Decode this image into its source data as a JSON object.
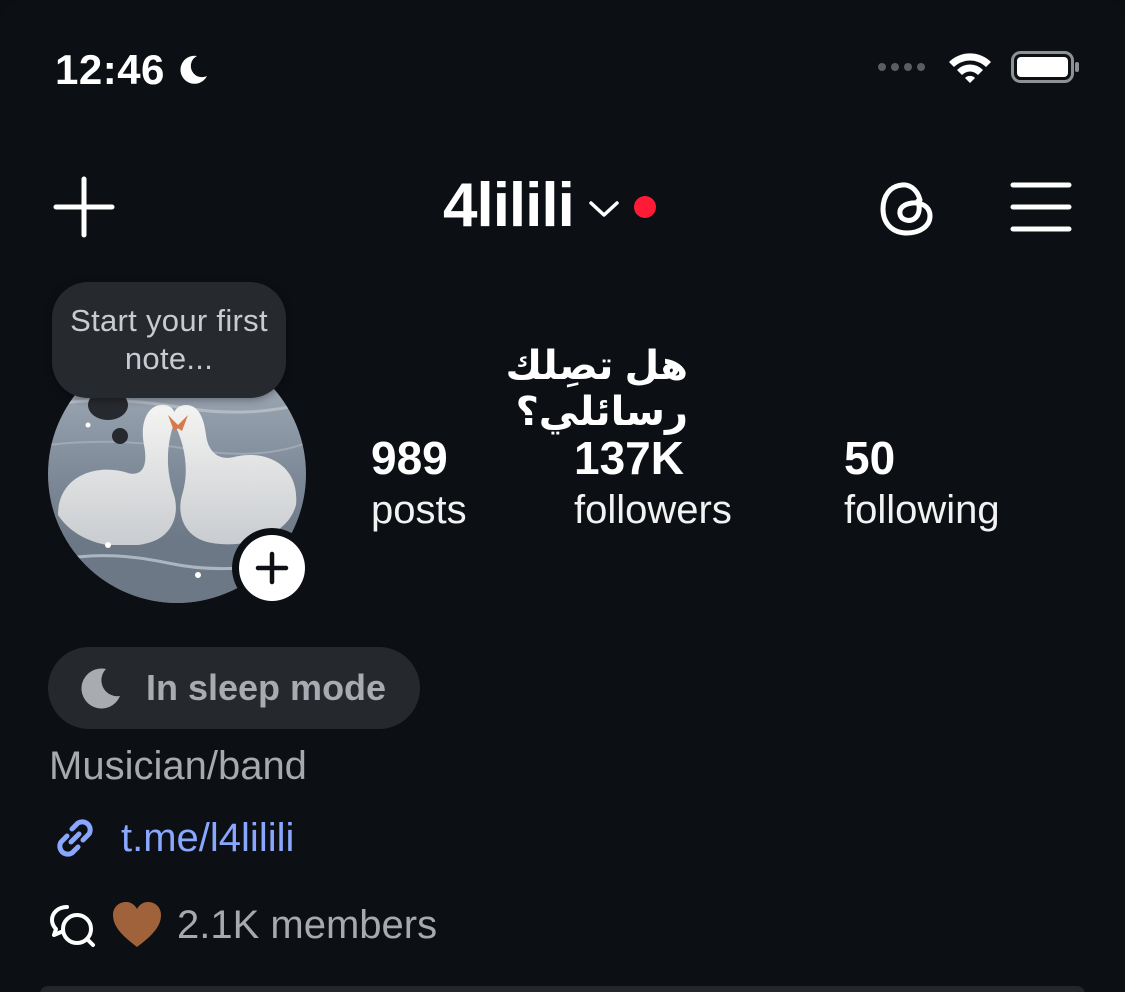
{
  "status_bar": {
    "time": "12:46"
  },
  "header": {
    "username": "4lilili"
  },
  "note": {
    "text": "Start your first note..."
  },
  "profile": {
    "bio_title": "هل تصِلك رسائلي؟",
    "stats": [
      {
        "value": "989",
        "label": "posts"
      },
      {
        "value": "137K",
        "label": "followers"
      },
      {
        "value": "50",
        "label": "following"
      }
    ],
    "sleep_mode": "In sleep mode",
    "category": "Musician/band",
    "link": "t.me/l4lilili",
    "members": "2.1K members"
  },
  "colors": {
    "background": "#0c0f14",
    "accent_red": "#ff1a36",
    "link_blue": "#8aa7ff",
    "heart_brown": "#a0623a"
  },
  "icons": [
    "moon-icon",
    "wifi-icon",
    "battery-icon",
    "plus-icon",
    "chevron-down-icon",
    "threads-icon",
    "menu-icon",
    "add-icon",
    "sleep-moon-icon",
    "link-icon",
    "chat-icon",
    "brown-heart-icon"
  ]
}
